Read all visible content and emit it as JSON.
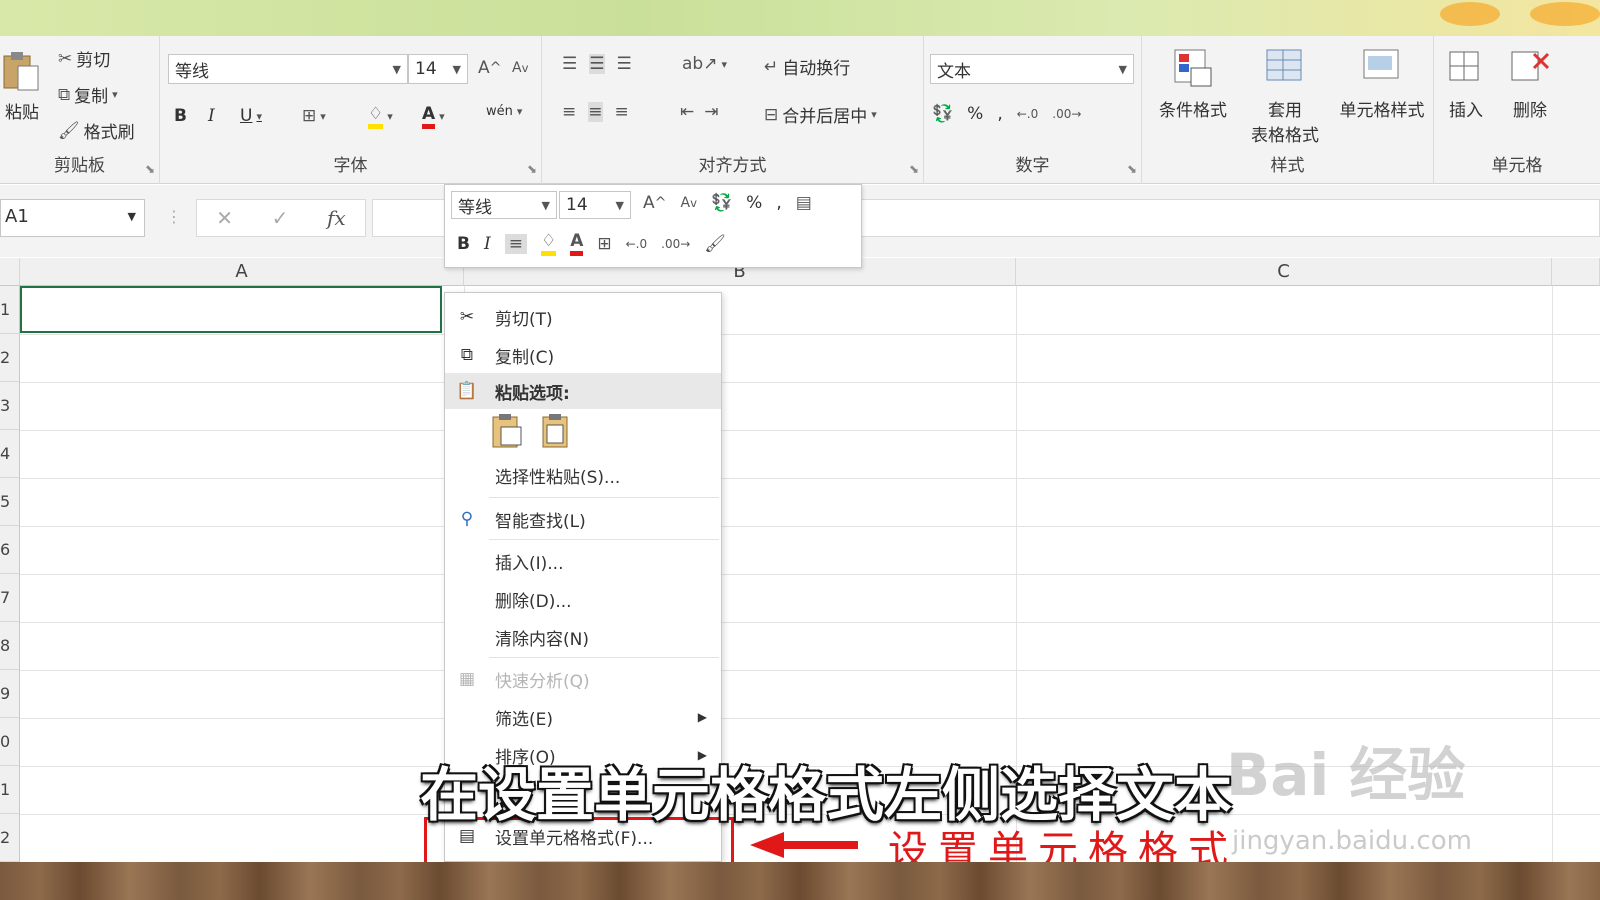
{
  "ribbon": {
    "clipboard": {
      "paste": "粘贴",
      "cut": "剪切",
      "copy": "复制",
      "format_painter": "格式刷",
      "label": "剪贴板"
    },
    "font": {
      "font_name": "等线",
      "font_size": "14",
      "bold": "B",
      "italic": "I",
      "underline": "U",
      "phonetic": "wén",
      "label": "字体"
    },
    "alignment": {
      "wrap_text": "自动换行",
      "merge_center": "合并后居中",
      "label": "对齐方式"
    },
    "number": {
      "format": "文本",
      "percent": "%",
      "comma": ",",
      "label": "数字"
    },
    "styles": {
      "conditional_format": "条件格式",
      "table_format_1": "套用",
      "table_format_2": "表格格式",
      "cell_styles": "单元格样式",
      "label": "样式"
    },
    "cells": {
      "insert": "插入",
      "delete": "删除",
      "label": "单元格"
    }
  },
  "formula_bar": {
    "name_box": "A1",
    "fx": "fx"
  },
  "columns": [
    "A",
    "B",
    "C"
  ],
  "rows": [
    "1",
    "2",
    "3",
    "4",
    "5",
    "6",
    "7",
    "8",
    "9",
    "0",
    "1",
    "2"
  ],
  "mini_toolbar": {
    "font_name": "等线",
    "font_size": "14",
    "bold": "B",
    "italic": "I",
    "percent": "%",
    "comma": ","
  },
  "context_menu": {
    "cut": "剪切(T)",
    "copy": "复制(C)",
    "paste_options": "粘贴选项:",
    "paste_special": "选择性粘贴(S)...",
    "smart_lookup": "智能查找(L)",
    "insert": "插入(I)...",
    "delete": "删除(D)...",
    "clear_contents": "清除内容(N)",
    "quick_analysis": "快速分析(Q)",
    "filter": "筛选(E)",
    "sort": "排序(O)",
    "format_cells": "设置单元格格式(F)..."
  },
  "caption": "在设置单元格格式左侧选择文本",
  "annotation": "设置单元格格式",
  "watermark": "Bai 经验",
  "watermark_url": "jingyan.baidu.com",
  "colors": {
    "excel_green": "#217346",
    "annotation_red": "#e01818"
  }
}
